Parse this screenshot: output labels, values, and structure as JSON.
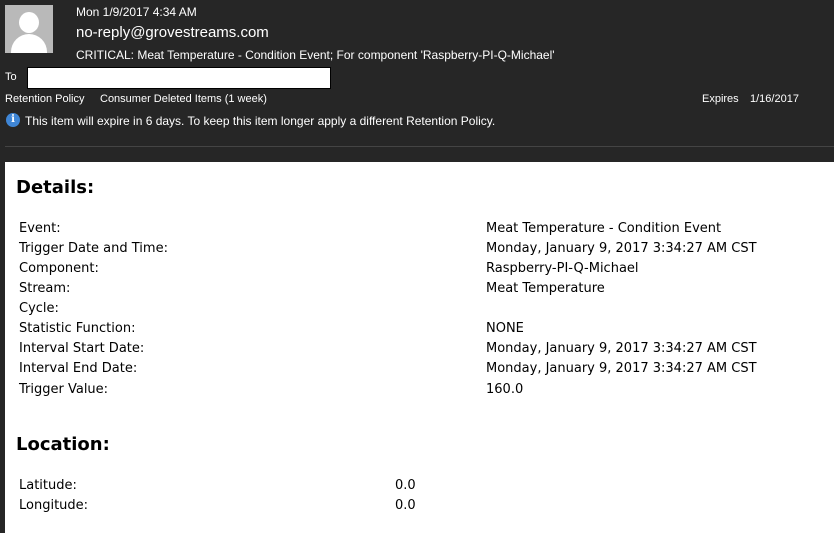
{
  "header": {
    "date": "Mon 1/9/2017 4:34 AM",
    "sender": "no-reply@grovestreams.com",
    "subject": "CRITICAL: Meat Temperature - Condition Event; For component 'Raspberry-PI-Q-Michael'",
    "to_label": "To",
    "retention_label": "Retention Policy",
    "retention_value": "Consumer Deleted Items (1 week)",
    "expires_label": "Expires",
    "expires_value": "1/16/2017",
    "info_text": "This item will expire in 6 days. To keep this item longer apply a different Retention Policy.",
    "info_icon": "info-icon"
  },
  "details": {
    "title": "Details:",
    "rows": [
      {
        "label": "Event:",
        "value": "Meat Temperature - Condition Event"
      },
      {
        "label": "Trigger Date and Time:",
        "value": "Monday, January 9, 2017 3:34:27 AM CST"
      },
      {
        "label": "Component:",
        "value": "Raspberry-PI-Q-Michael"
      },
      {
        "label": "Stream:",
        "value": "Meat Temperature"
      },
      {
        "label": "Cycle:",
        "value": ""
      },
      {
        "label": "Statistic Function:",
        "value": "NONE"
      },
      {
        "label": "Interval Start Date:",
        "value": "Monday, January 9, 2017 3:34:27 AM CST"
      },
      {
        "label": "Interval End Date:",
        "value": "Monday, January 9, 2017 3:34:27 AM CST"
      },
      {
        "label": "Trigger Value:",
        "value": "160.0"
      }
    ]
  },
  "location": {
    "title": "Location:",
    "rows": [
      {
        "label": "Latitude:",
        "value": "0.0"
      },
      {
        "label": "Longitude:",
        "value": "0.0"
      }
    ]
  }
}
